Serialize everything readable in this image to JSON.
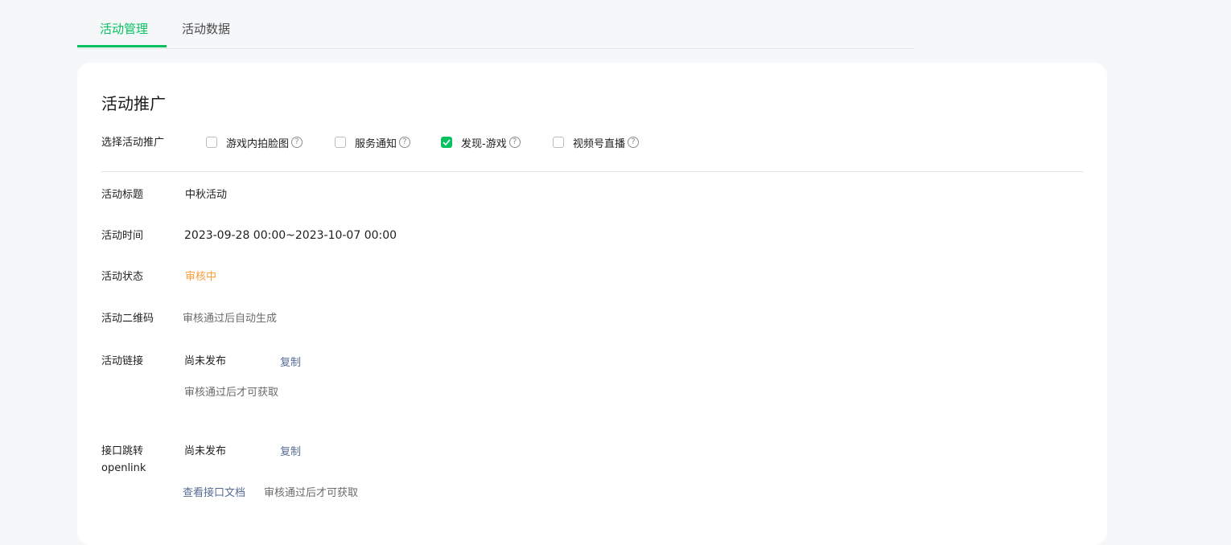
{
  "tabs": [
    {
      "label": "活动管理",
      "active": true
    },
    {
      "label": "活动数据",
      "active": false
    }
  ],
  "section_title": "活动推广",
  "promotion": {
    "label": "选择活动推广",
    "options": [
      {
        "label": "游戏内拍脸图",
        "checked": false,
        "help_icon": "question-icon"
      },
      {
        "label": "服务通知",
        "checked": false,
        "help_icon": "question-icon"
      },
      {
        "label": "发现-游戏",
        "checked": true,
        "help_icon": "question-icon"
      },
      {
        "label": "视频号直播",
        "checked": false,
        "help_icon": "question-icon"
      }
    ]
  },
  "details": {
    "title_label": "活动标题",
    "title_value": "中秋活动",
    "time_label": "活动时间",
    "time_value": "2023-09-28 00:00~2023-10-07 00:00",
    "status_label": "活动状态",
    "status_value": "审核中",
    "qr_label": "活动二维码",
    "qr_value": "审核通过后自动生成",
    "link_label": "活动链接",
    "link_value": "尚未发布",
    "link_copy": "复制",
    "link_hint": "审核通过后才可获取",
    "openlink_label_1": "接口跳转",
    "openlink_label_2": "openlink",
    "openlink_value": "尚未发布",
    "openlink_copy": "复制",
    "openlink_doc": "查看接口文档",
    "openlink_hint": "审核通过后才可获取"
  },
  "colors": {
    "accent": "#07c160",
    "status_pending": "#fa9d3b",
    "link": "#576b95"
  }
}
